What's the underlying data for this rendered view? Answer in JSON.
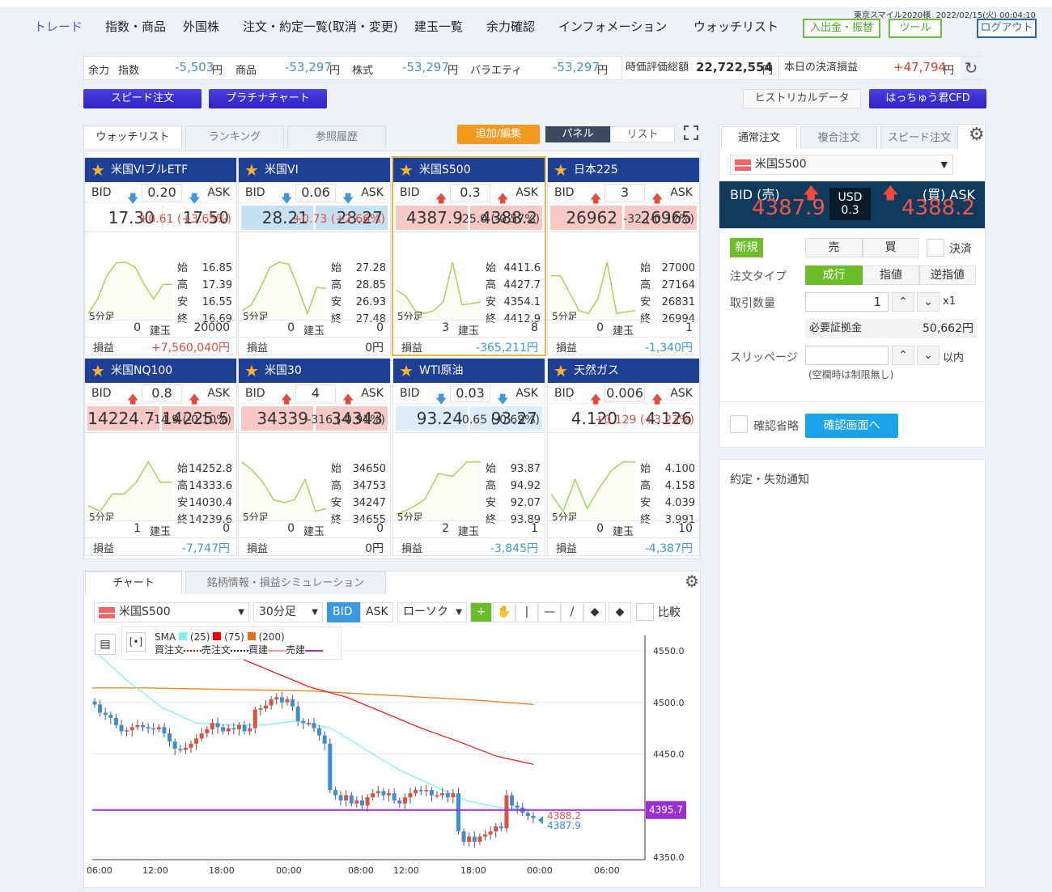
{
  "header": {
    "nav": [
      "トレード",
      "指数・商品",
      "外国株",
      "注文・約定一覧(取消・変更)",
      "建玉一覧",
      "余力確認",
      "インフォメーション",
      "ウォッチリスト"
    ],
    "deposit": "入出金・振替",
    "tools": "ツール",
    "logout": "ログアウト",
    "user": "東京スマイル2020様",
    "datetime": "2022/02/15(火) 00:04:10"
  },
  "balance": {
    "label": "余力",
    "index_label": "指数",
    "index": "-5,503",
    "commodity_label": "商品",
    "commodity": "-53,297",
    "stock_label": "株式",
    "stock": "-53,297",
    "variety_label": "バラエティ",
    "variety": "-53,297",
    "yen": "円",
    "valuation_label": "時価評価総額",
    "valuation": "22,722,554",
    "pl_label": "本日の決済損益",
    "pl": "+47,794"
  },
  "buttons": {
    "speed": "スピード注文",
    "platinum": "プラチナチャート",
    "historical": "ヒストリカルデータ",
    "cfd": "はっちゅう君CFD"
  },
  "watchlist": {
    "tabs": [
      "ウォッチリスト",
      "ランキング",
      "参照履歴"
    ],
    "add_edit": "追加/編集",
    "view_panel": "パネル",
    "view_list": "リスト",
    "labels": {
      "bid": "BID",
      "ask": "ASK",
      "open": "始",
      "high": "高",
      "low": "安",
      "close": "終",
      "frame": "5分足",
      "position": "建玉",
      "pl": "損益"
    },
    "items": [
      {
        "name": "米国VIブルETF",
        "dir": "down",
        "spread": "0.20",
        "bid": "17.30",
        "ask": "17.50",
        "hl": "none",
        "change": "+0.61 (+3.65%)",
        "cdir": "up",
        "open": "16.85",
        "high": "17.39",
        "low": "16.55",
        "close": "16.69",
        "pos_sell": "0",
        "pos_buy": "20000",
        "pl": "+7,560,040円",
        "spark": [
          0.05,
          0.3,
          0.7,
          0.92,
          0.93,
          0.85,
          0.55,
          0.3,
          0.55,
          0.55
        ]
      },
      {
        "name": "米国VI",
        "dir": "down",
        "spread": "0.06",
        "bid": "28.21",
        "ask": "28.27",
        "hl": "blue",
        "change": "+0.73 (+2.66%)",
        "cdir": "up",
        "open": "27.28",
        "high": "28.85",
        "low": "26.93",
        "close": "27.48",
        "pos_sell": "0",
        "pos_buy": "0",
        "pl": "0円",
        "spark": [
          0.1,
          0.2,
          0.5,
          0.85,
          0.93,
          0.9,
          0.5,
          0.05,
          0.5,
          0.48
        ]
      },
      {
        "name": "米国S500",
        "dir": "up",
        "spread": "0.3",
        "bid": "4387.9",
        "ask": "4388.2",
        "hl": "pink",
        "change": "-25.0 (-0.57%)",
        "cdir": "down",
        "open": "4411.6",
        "high": "4427.7",
        "low": "4354.1",
        "close": "4412.9",
        "pos_sell": "3",
        "pos_buy": "8",
        "pl": "-365,211円",
        "spark": [
          0.45,
          0.35,
          0.1,
          0.05,
          0.1,
          0.25,
          0.93,
          0.2,
          0.22,
          0.25
        ]
      },
      {
        "name": "日本225",
        "dir": "up",
        "spread": "3",
        "bid": "26962",
        "ask": "26965",
        "hl": "pink",
        "change": "-32 (-0.12%)",
        "cdir": "down",
        "open": "27000",
        "high": "27164",
        "low": "26831",
        "close": "26994",
        "pos_sell": "0",
        "pos_buy": "1",
        "pl": "-1,340円",
        "spark": [
          0.7,
          0.7,
          0.4,
          0.1,
          0.05,
          0.3,
          0.93,
          0.05,
          0.08,
          0.1
        ]
      },
      {
        "name": "米国NQ100",
        "dir": "up",
        "spread": "0.8",
        "bid": "14224.7",
        "ask": "14225.5",
        "hl": "pink",
        "change": "-14.9 (-0.10%)",
        "cdir": "down",
        "open": "14252.8",
        "high": "14333.6",
        "low": "14030.4",
        "close": "14239.6",
        "pos_sell": "1",
        "pos_buy": "0",
        "pl": "-7,747円",
        "spark": [
          0.2,
          0.1,
          0.4,
          0.4,
          0.6,
          0.95,
          0.6,
          0.6
        ]
      },
      {
        "name": "米国30",
        "dir": "up",
        "spread": "4",
        "bid": "34339",
        "ask": "34343",
        "hl": "pink",
        "change": "-316 (-0.91%)",
        "cdir": "down",
        "open": "34650",
        "high": "34753",
        "low": "34247",
        "close": "34655",
        "pos_sell": "0",
        "pos_buy": "0",
        "pl": "0円",
        "spark": [
          0.95,
          0.8,
          0.6,
          0.3,
          0.25,
          0.3,
          0.65,
          0.1,
          0.15
        ]
      },
      {
        "name": "WTI原油",
        "dir": "down",
        "spread": "0.03",
        "bid": "93.24",
        "ask": "93.27",
        "hl": "lightblue",
        "change": "-0.65 (-0.69%)",
        "cdir": "down",
        "open": "93.87",
        "high": "94.92",
        "low": "92.07",
        "close": "93.89",
        "pos_sell": "2",
        "pos_buy": "1",
        "pl": "-3,845円",
        "spark": [
          0.05,
          0.15,
          0.3,
          0.75,
          0.7,
          0.95,
          0.95
        ]
      },
      {
        "name": "天然ガス",
        "dir": "up",
        "spread": "0.006",
        "bid": "4.120",
        "ask": "4.126",
        "hl": "none",
        "change": "+0.129 (+3.23%)",
        "cdir": "up",
        "open": "4.100",
        "high": "4.158",
        "low": "4.039",
        "close": "3.991",
        "pos_sell": "0",
        "pos_buy": "10",
        "pl": "-4,387円",
        "spark": [
          0.4,
          0.1,
          0.65,
          0.15,
          0.5,
          0.8,
          0.95,
          0.95
        ]
      }
    ]
  },
  "order": {
    "tabs": [
      "通常注文",
      "複合注文",
      "スピード注文"
    ],
    "symbol": "米国S500",
    "bid_label": "BID (売)",
    "ask_label": "(買) ASK",
    "bid": "4387.9",
    "ask": "4388.2",
    "currency": "USD",
    "spread": "0.3",
    "new_label": "新規",
    "sell": "売",
    "buy": "買",
    "settle": "決済",
    "type_label": "注文タイプ",
    "types": [
      "成行",
      "指値",
      "逆指値"
    ],
    "qty_label": "取引数量",
    "qty": "1",
    "multiplier": "x1",
    "margin_label": "必要証拠金",
    "margin": "50,662円",
    "slip_label": "スリッページ",
    "slip_unit": "以内",
    "slip_note": "(空欄時は制限無し)",
    "skip_confirm": "確認省略",
    "confirm": "確認画面へ"
  },
  "notifications": {
    "title": "約定・失効通知"
  },
  "chart_panel": {
    "tabs": [
      "チャート",
      "銘柄情報・損益シミュレーション"
    ],
    "symbol": "米国S500",
    "timeframe": "30分足",
    "bid": "BID",
    "ask": "ASK",
    "style": "ローソク",
    "compare": "比較",
    "legend": {
      "sma": "SMA",
      "p1": "(25)",
      "p2": "(75)",
      "p3": "(200)",
      "buy_order": "買注文",
      "sell_order": "売注文",
      "buy_pos": "買建",
      "sell_pos": "売建"
    }
  },
  "colors": {
    "navy": "#1f3f95",
    "up": "#e54a3c",
    "down": "#3f97dc",
    "green": "#6cbd2a",
    "sma25": "#7ff0f0",
    "sma75": "#f02020",
    "sma200": "#f08020"
  },
  "chart_data": {
    "type": "candlestick",
    "ylim": [
      4340,
      4560
    ],
    "yticks": [
      "4550.0",
      "4500.0",
      "4450.0",
      "4350.0"
    ],
    "ytick_values": [
      4550,
      4500,
      4450,
      4350
    ],
    "xticks": [
      "06:00",
      "12:00",
      "18:00",
      "00:00",
      "08:00",
      "12:00",
      "18:00",
      "00:00",
      "06:00"
    ],
    "closes": [
      4498,
      4490,
      4488,
      4485,
      4478,
      4472,
      4473,
      4476,
      4478,
      4476,
      4475,
      4474,
      4476,
      4470,
      4462,
      4455,
      4454,
      4456,
      4460,
      4465,
      4470,
      4474,
      4480,
      4476,
      4472,
      4475,
      4474,
      4478,
      4472,
      4475,
      4493,
      4494,
      4497,
      4503,
      4505,
      4500,
      4503,
      4496,
      4482,
      4480,
      4480,
      4475,
      4468,
      4460,
      4415,
      4410,
      4405,
      4410,
      4402,
      4405,
      4400,
      4408,
      4412,
      4414,
      4410,
      4412,
      4405,
      4402,
      4408,
      4412,
      4415,
      4414,
      4415,
      4410,
      4410,
      4412,
      4408,
      4412,
      4375,
      4365,
      4370,
      4365,
      4370,
      4372,
      4375,
      4380,
      4378,
      4410,
      4400,
      4398,
      4393,
      4390,
      4388
    ],
    "sma25": [
      4550,
      4520,
      4495,
      4480,
      4478,
      4478,
      4482,
      4475,
      4455,
      4435,
      4420,
      4405,
      4398,
      4396
    ],
    "sma75": [
      4560,
      4545,
      4530,
      4515,
      4505,
      4490,
      4475,
      4462,
      4448,
      4440
    ],
    "sma200": [
      4514,
      4514,
      4513,
      4512,
      4511,
      4508,
      4505,
      4502,
      4498
    ],
    "price_line": "4395.7",
    "ask_label": "4388.2",
    "bid_label": "4387.9"
  }
}
